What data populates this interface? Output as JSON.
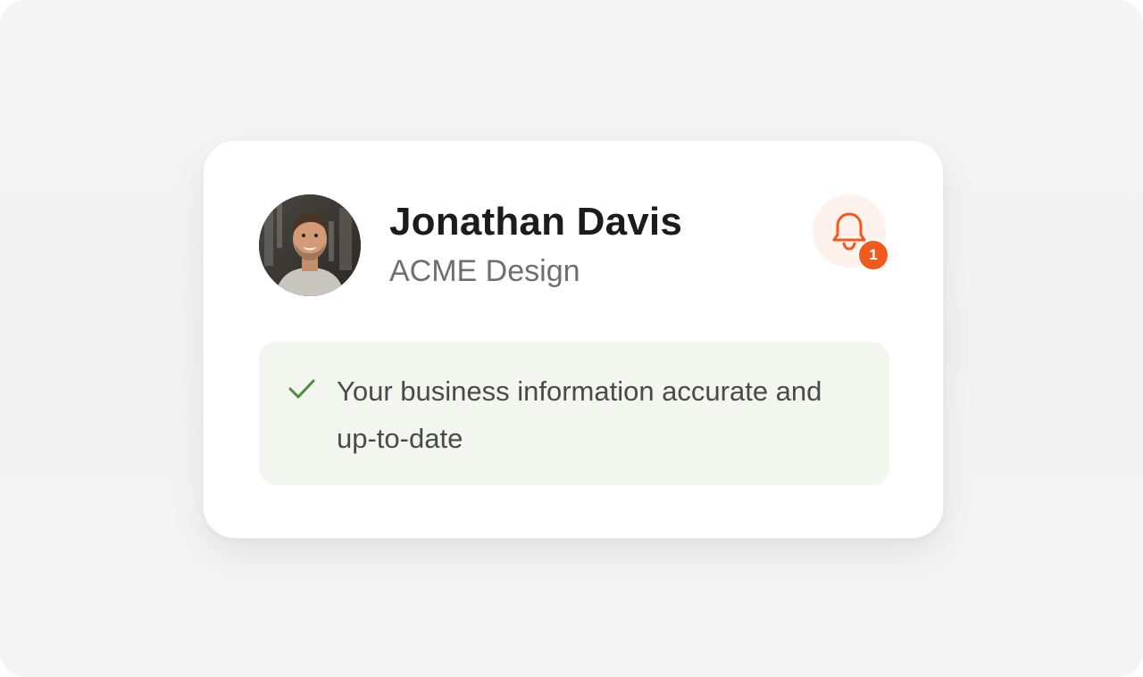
{
  "profile": {
    "name": "Jonathan Davis",
    "company": "ACME Design"
  },
  "notifications": {
    "count": "1",
    "icon": "bell-icon",
    "accent_color": "#f05a1f",
    "button_bg": "#fff2ec"
  },
  "status": {
    "icon": "check-icon",
    "message": "Your business information accurate and up-to-date",
    "check_color": "#4f8a3a",
    "background": "#f2f6ef"
  }
}
